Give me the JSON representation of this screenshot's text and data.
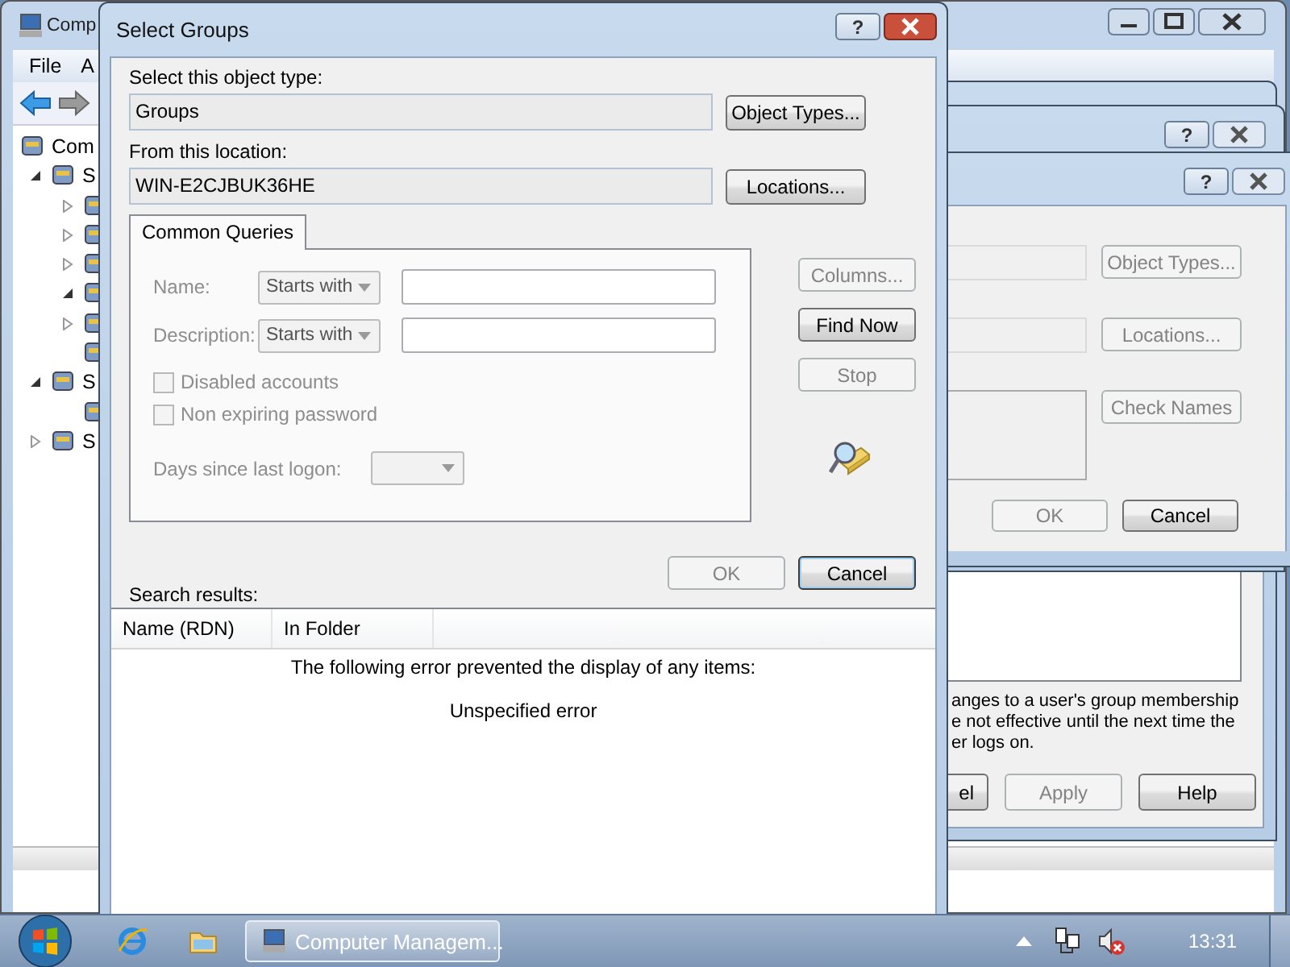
{
  "computer_management": {
    "title": "Comp",
    "menu": [
      {
        "label": "File"
      },
      {
        "label": "A"
      }
    ],
    "tree": [
      {
        "label": "Com",
        "kind": "root",
        "children": [
          {
            "label": "S",
            "kind": "folder",
            "expanded": true,
            "children": [
              {
                "kind": "folder",
                "expanded": false
              },
              {
                "kind": "folder",
                "expanded": false
              },
              {
                "kind": "folder",
                "expanded": false
              },
              {
                "kind": "folder",
                "expanded": true
              },
              {
                "kind": "folder",
                "expanded": false
              },
              {
                "kind": "leaf"
              }
            ]
          },
          {
            "label": "S",
            "kind": "folder",
            "expanded": true,
            "children": [
              {
                "kind": "leaf"
              }
            ]
          },
          {
            "label": "S",
            "kind": "folder",
            "expanded": false
          }
        ]
      }
    ]
  },
  "properties_dialog": {
    "note_lines": [
      "anges to a user's group membership",
      "e not effective until the next time the",
      "er logs on."
    ],
    "buttons": [
      {
        "label": "el",
        "disabled": false
      },
      {
        "label": "Apply",
        "disabled": true
      },
      {
        "label": "Help",
        "disabled": false
      }
    ]
  },
  "select_dialog_back": {
    "help_button": "?"
  },
  "select_dialog_middle": {
    "help_button": "?",
    "buttons": [
      {
        "label": "Object Types...",
        "disabled": true
      },
      {
        "label": "Locations...",
        "disabled": true
      },
      {
        "label": "Check Names",
        "disabled": true
      }
    ],
    "footer_buttons": [
      {
        "label": "OK",
        "disabled": true
      },
      {
        "label": "Cancel",
        "disabled": false
      }
    ]
  },
  "select_groups": {
    "title": "Select Groups",
    "help_button": "?",
    "object_type": {
      "label": "Select this object type:",
      "value": "Groups",
      "button": "Object Types..."
    },
    "location": {
      "label": "From this location:",
      "value": "WIN-E2CJBUK36HE",
      "button": "Locations..."
    },
    "tabs": [
      {
        "label": "Common Queries",
        "selected": true
      }
    ],
    "query_rows": [
      {
        "label": "Name:",
        "operator": "Starts with",
        "disabled": true
      },
      {
        "label": "Description:",
        "operator": "Starts with",
        "disabled": true
      }
    ],
    "checkboxes": [
      {
        "label": "Disabled accounts",
        "checked": false,
        "disabled": true
      },
      {
        "label": "Non expiring password",
        "checked": false,
        "disabled": true
      }
    ],
    "days_since_logon": {
      "label": "Days since last logon:",
      "disabled": true
    },
    "side_buttons": [
      {
        "label": "Columns...",
        "disabled": true
      },
      {
        "label": "Find Now",
        "disabled": false
      },
      {
        "label": "Stop",
        "disabled": true
      }
    ],
    "buttons": [
      {
        "label": "OK",
        "disabled": true
      },
      {
        "label": "Cancel",
        "disabled": false
      }
    ],
    "results": {
      "label": "Search results:",
      "columns": [
        "Name (RDN)",
        "In Folder"
      ],
      "message_lines": [
        "The following error prevented the display of any items:",
        "Unspecified error"
      ]
    }
  },
  "taskbar": {
    "tasks": [
      {
        "label": "Computer Managem..."
      }
    ],
    "clock": "13:31"
  }
}
